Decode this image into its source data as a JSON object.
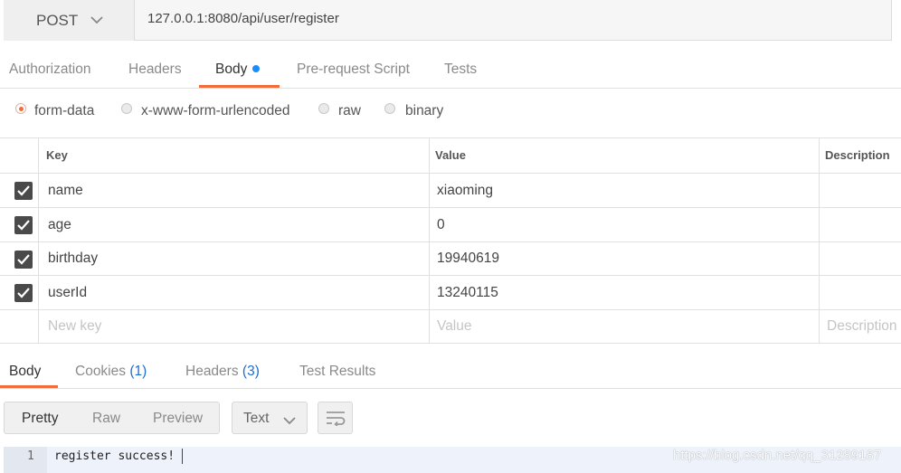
{
  "request": {
    "method": "POST",
    "url": "127.0.0.1:8080/api/user/register"
  },
  "request_tabs": [
    "Authorization",
    "Headers",
    "Body",
    "Pre-request Script",
    "Tests"
  ],
  "body_modes": [
    "form-data",
    "x-www-form-urlencoded",
    "raw",
    "binary"
  ],
  "table": {
    "headers": [
      "Key",
      "Value",
      "Description"
    ],
    "rows": [
      {
        "key": "name",
        "value": "xiaoming"
      },
      {
        "key": "age",
        "value": "0"
      },
      {
        "key": "birthday",
        "value": "19940619"
      },
      {
        "key": "userId",
        "value": "13240115"
      }
    ],
    "placeholders": {
      "key": "New key",
      "value": "Value",
      "description": "Description"
    }
  },
  "response_tabs": {
    "body": "Body",
    "cookies": "Cookies",
    "cookies_count": "(1)",
    "headers": "Headers",
    "headers_count": "(3)",
    "test_results": "Test Results"
  },
  "format": {
    "pretty": "Pretty",
    "raw": "Raw",
    "preview": "Preview",
    "type": "Text"
  },
  "response_body": {
    "line_number": "1",
    "text": "register success!"
  },
  "watermark": "https://blog.csdn.net/qq_31289187",
  "colors": {
    "accent": "#f26b3a",
    "dot": "#1d8cf8",
    "link_count": "#1d6fd1"
  }
}
